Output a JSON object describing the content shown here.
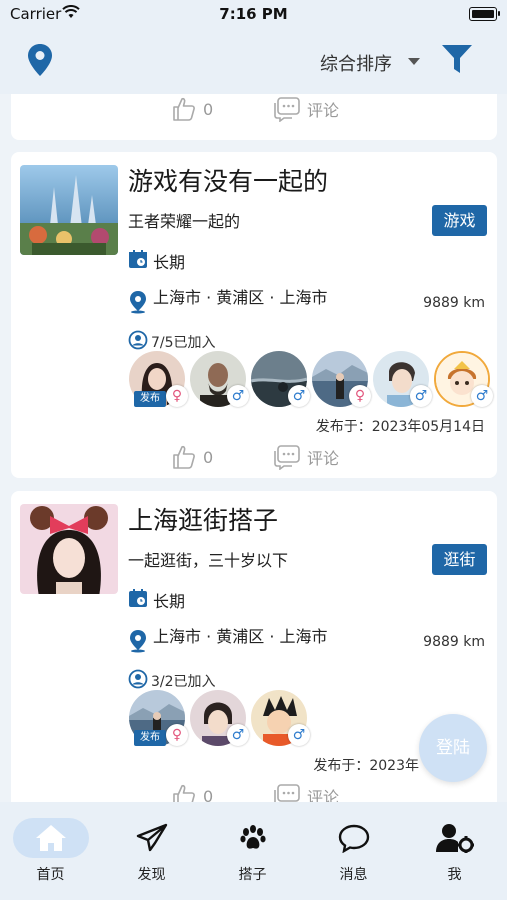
{
  "status_bar": {
    "carrier": "Carrier",
    "time": "7:16 PM"
  },
  "nav": {
    "sort_label": "综合排序",
    "location_icon": "location-pin-icon",
    "filter_icon": "filter-icon"
  },
  "top_card_actions": {
    "likes": "0",
    "comment": "评论"
  },
  "posts": [
    {
      "title": "游戏有没有一起的",
      "description": "王者荣耀一起的",
      "tag": "游戏",
      "duration": "长期",
      "location": "上海市 · 黄浦区 · 上海市",
      "distance": "9889 km",
      "joined": "7/5已加入",
      "publisher_badge": "发布",
      "genders": [
        "female",
        "male",
        "male",
        "female",
        "male",
        "male"
      ],
      "published": "发布于：2023年05月14日",
      "likes": "0",
      "comment": "评论"
    },
    {
      "title": "上海逛街搭子",
      "description": "一起逛街，三十岁以下",
      "tag": "逛街",
      "duration": "长期",
      "location": "上海市 · 黄浦区 · 上海市",
      "distance": "9889 km",
      "joined": "3/2已加入",
      "publisher_badge": "发布",
      "genders": [
        "female",
        "male",
        "male"
      ],
      "published": "发布于：2023年",
      "likes": "0",
      "comment": "评论"
    }
  ],
  "login_button": "登陆",
  "tabbar": [
    {
      "label": "首页",
      "icon": "home-icon",
      "active": true
    },
    {
      "label": "发现",
      "icon": "paper-plane-icon",
      "active": false
    },
    {
      "label": "搭子",
      "icon": "paw-icon",
      "active": false
    },
    {
      "label": "消息",
      "icon": "chat-bubble-icon",
      "active": false
    },
    {
      "label": "我",
      "icon": "user-settings-icon",
      "active": false
    }
  ],
  "colors": {
    "accent": "#1f67a7",
    "female": "#e2577d",
    "male": "#2f7ccd",
    "background": "#eef3f8"
  }
}
